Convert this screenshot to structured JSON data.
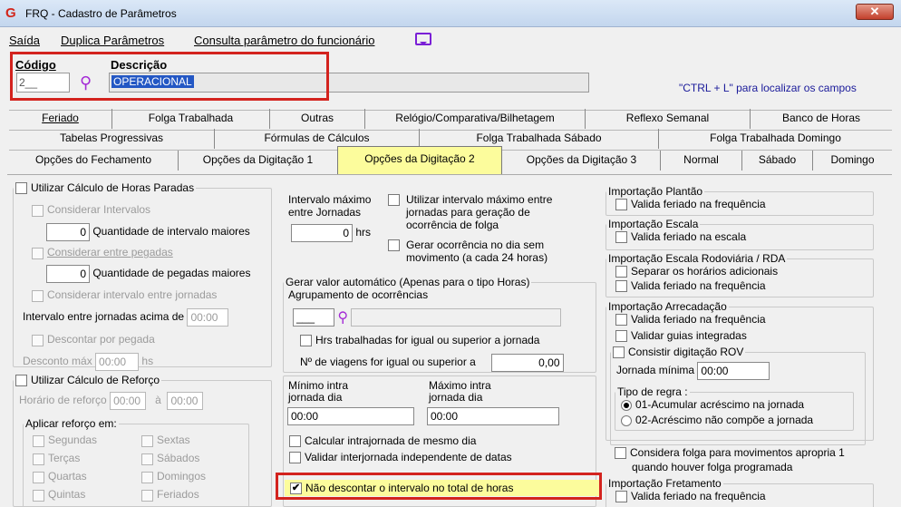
{
  "window": {
    "title": "FRQ - Cadastro de Parâmetros",
    "close": "✕"
  },
  "menu": [
    "Saída",
    "Duplica Parâmetros",
    "Consulta parâmetro do funcionário"
  ],
  "header": {
    "code_label": "Código",
    "desc_label": "Descrição",
    "code_value": "2__",
    "desc_value": "OPERACIONAL",
    "hint": "\"CTRL + L\" para localizar os campos"
  },
  "tabs_row1": [
    "Feriado",
    "Folga Trabalhada",
    "Outras",
    "Relógio/Comparativa/Bilhetagem",
    "Reflexo Semanal",
    "Banco de Horas"
  ],
  "tabs_row2": [
    "Tabelas Progressivas",
    "Fórmulas de Cálculos",
    "Folga Trabalhada Sábado",
    "Folga Trabalhada Domingo"
  ],
  "tabs_row3": [
    "Opções do Fechamento",
    "Opções da Digitação 1",
    "Opções da Digitação 2",
    "Opções da Digitação 3",
    "Normal",
    "Sábado",
    "Domingo"
  ],
  "paradas": {
    "legend": "Utilizar Cálculo de Horas Paradas",
    "considerar_intervalos": "Considerar Intervalos",
    "qtd_intervalo_value": "0",
    "qtd_intervalo_label": "Quantidade de intervalo maiores",
    "considerar_pegadas": "Considerar entre pegadas",
    "qtd_pegadas_value": "0",
    "qtd_pegadas_label": "Quantidade de pegadas maiores",
    "considerar_jornadas": "Considerar intervalo entre jornadas",
    "intervalo_jornadas_label": "Intervalo entre jornadas acima de",
    "intervalo_jornadas_value": "00:00",
    "descontar_pegada": "Descontar por pegada",
    "desconto_max_label": "Desconto máx",
    "desconto_max_value": "00:00",
    "desconto_max_unit": "hs"
  },
  "reforco": {
    "legend": "Utilizar Cálculo de Reforço",
    "horario_label": "Horário de reforço",
    "horario_from": "00:00",
    "horario_sep": "à",
    "horario_to": "00:00",
    "aplicar_legend": "Aplicar reforço em:",
    "days_left": [
      "Segundas",
      "Terças",
      "Quartas",
      "Quintas"
    ],
    "days_right": [
      "Sextas",
      "Sábados",
      "Domingos",
      "Feriados"
    ]
  },
  "intervalo": {
    "label": "Intervalo máximo entre Jornadas",
    "value": "0",
    "unit": "hrs",
    "usar_max": "Utilizar intervalo máximo entre jornadas para geração de ocorrência de folga",
    "gerar_ocorrencia": "Gerar ocorrência no dia sem movimento (a cada 24 horas)"
  },
  "gerar_valor": {
    "legend": "Gerar valor automático (Apenas para o tipo Horas)",
    "agrupamento_label": "Agrupamento de ocorrências",
    "agrupamento_value": "___",
    "hrs_trabalhadas": "Hrs trabalhadas for igual ou superior a jornada",
    "viagens_label": "Nº de viagens for igual ou superior a",
    "viagens_value": "0,00"
  },
  "intrajornada": {
    "min_label": "Mínimo intra jornada dia",
    "min_value": "00:00",
    "max_label": "Máximo intra jornada dia",
    "max_value": "00:00",
    "calcular": "Calcular intrajornada de mesmo dia",
    "validar": "Validar interjornada independente de datas",
    "nao_descontar": "Não descontar o intervalo no total de horas"
  },
  "right": {
    "plantao_legend": "Importação Plantão",
    "plantao_feriado": "Valida feriado na frequência",
    "escala_legend": "Importação Escala",
    "escala_feriado": "Valida feriado na escala",
    "rodoviaria_legend": "Importação Escala Rodoviária / RDA",
    "rodoviaria_separar": "Separar os horários adicionais",
    "rodoviaria_feriado": "Valida feriado na frequência",
    "arrecadacao_legend": "Importação Arrecadação",
    "arrecadacao_feriado": "Valida feriado na frequência",
    "arrecadacao_guias": "Validar guias integradas",
    "rov_legend": "Consistir digitação ROV",
    "jornada_label": "Jornada mínima",
    "jornada_value": "00:00",
    "tipo_legend": "Tipo de regra :",
    "tipo_opt1": "01-Acumular acréscimo na jornada",
    "tipo_opt2": "02-Acréscimo não compõe a jornada",
    "folga_line1": "Considera folga para movimentos apropria 1",
    "folga_line2": "quando houver folga programada",
    "fretamento_legend": "Importação Fretamento",
    "fretamento_feriado": "Valida feriado na frequência"
  }
}
